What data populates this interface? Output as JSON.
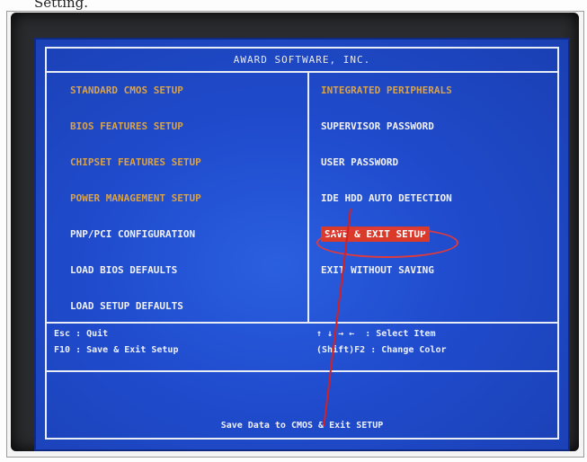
{
  "doc": {
    "heading": "Setting."
  },
  "bios": {
    "title": "AWARD SOFTWARE, INC.",
    "left_menu": [
      "STANDARD CMOS SETUP",
      "BIOS FEATURES SETUP",
      "CHIPSET FEATURES SETUP",
      "POWER MANAGEMENT SETUP",
      "PNP/PCI CONFIGURATION",
      "LOAD BIOS DEFAULTS",
      "LOAD SETUP DEFAULTS"
    ],
    "right_menu": [
      "INTEGRATED PERIPHERALS",
      "SUPERVISOR PASSWORD",
      "USER PASSWORD",
      "IDE HDD AUTO DETECTION",
      "SAVE & EXIT SETUP",
      "EXIT WITHOUT SAVING"
    ],
    "selected_item": "SAVE & EXIT SETUP",
    "help": {
      "esc_key": "Esc",
      "esc_action": "Quit",
      "f10_key": "F10",
      "f10_action": "Save & Exit Setup",
      "arrows": "↑ ↓ → ←",
      "arrows_action": "Select Item",
      "shift_key": "(Shift)F2",
      "shift_action": "Change Color"
    },
    "footer": "Save Data to CMOS & Exit SETUP"
  },
  "colors": {
    "screen_blue": "#1c45c4",
    "menu_orange": "#d8a24a",
    "highlight_red": "#d93a2a",
    "annotation_red": "#e23a3a"
  }
}
